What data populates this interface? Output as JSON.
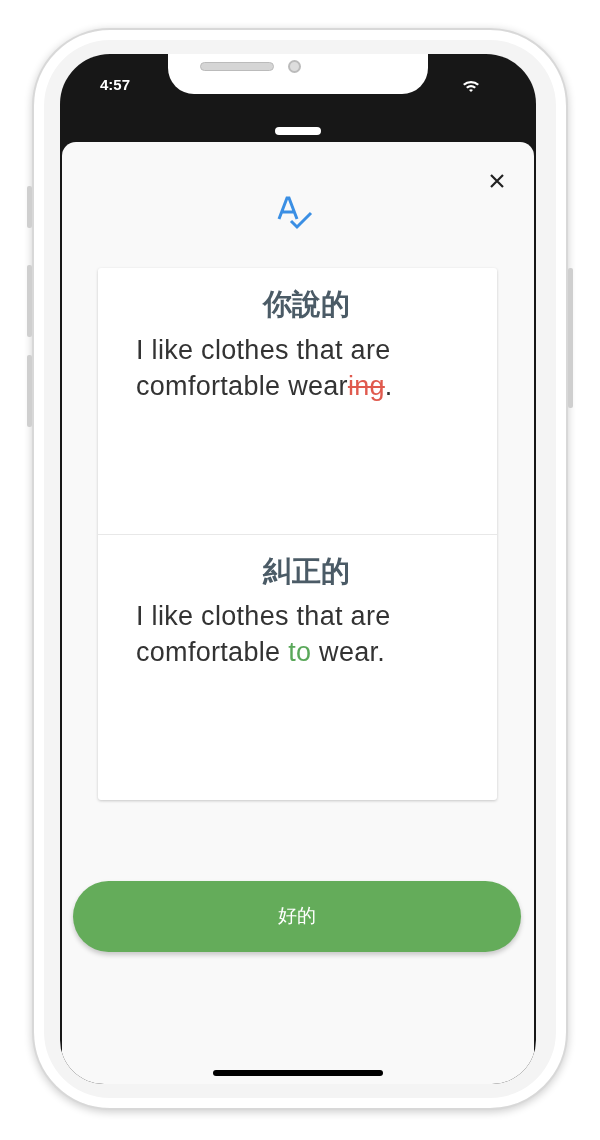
{
  "status_bar": {
    "time": "4:57"
  },
  "sheet": {
    "sections": [
      {
        "heading": "你說的",
        "segments": [
          {
            "kind": "plain",
            "text": "I like clothes that are comfortable wear"
          },
          {
            "kind": "deleted",
            "text": "ing"
          },
          {
            "kind": "plain",
            "text": "."
          }
        ]
      },
      {
        "heading": "糾正的",
        "segments": [
          {
            "kind": "plain",
            "text": "I like clothes that are comfortable "
          },
          {
            "kind": "inserted",
            "text": "to"
          },
          {
            "kind": "plain",
            "text": " wear."
          }
        ]
      }
    ],
    "button": "好的"
  }
}
